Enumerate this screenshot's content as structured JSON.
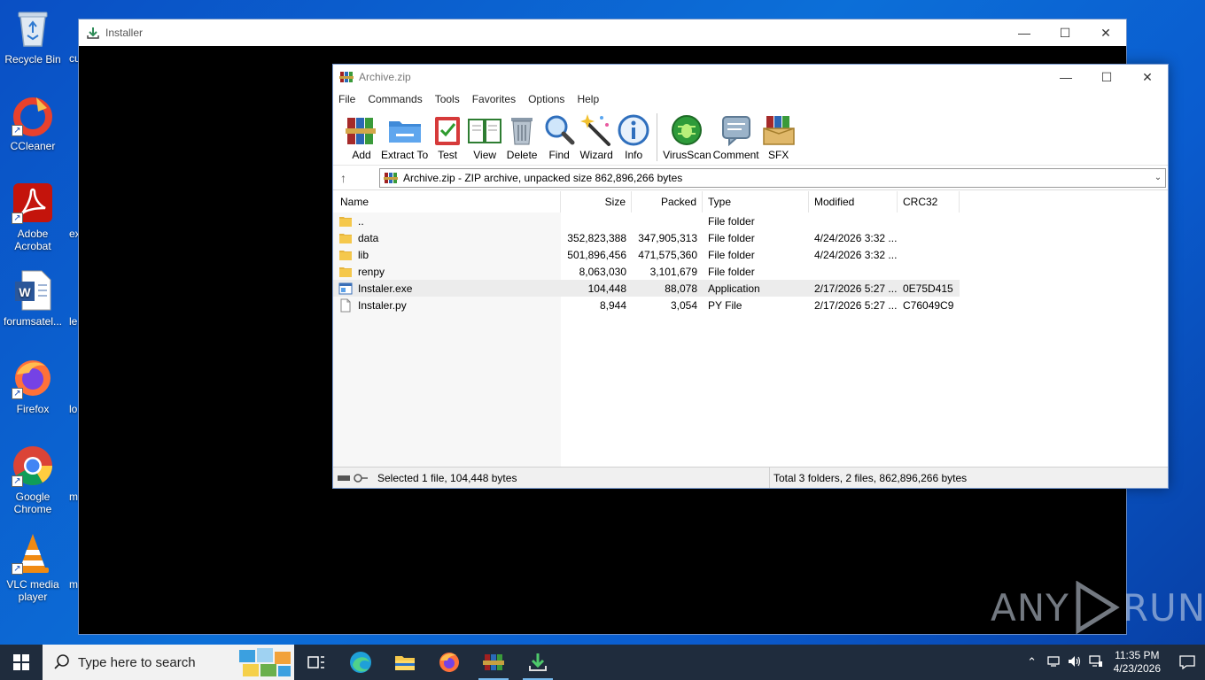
{
  "desktop": {
    "icons": [
      {
        "label": "Recycle Bin"
      },
      {
        "label": "CCleaner"
      },
      {
        "label": "Adobe Acrobat"
      },
      {
        "label": "forumsatel..."
      },
      {
        "label": "Firefox"
      },
      {
        "label": "Google Chrome"
      },
      {
        "label": "VLC media player"
      }
    ],
    "clipped_labels": [
      "cu",
      "ex",
      "le",
      "lo",
      "m",
      "m"
    ]
  },
  "installer_window": {
    "title": "Installer"
  },
  "winrar": {
    "title": "Archive.zip",
    "menu": [
      "File",
      "Commands",
      "Tools",
      "Favorites",
      "Options",
      "Help"
    ],
    "toolbar": [
      {
        "label": "Add",
        "icon": "add-books-icon"
      },
      {
        "label": "Extract To",
        "icon": "extract-folder-icon"
      },
      {
        "label": "Test",
        "icon": "test-clipboard-icon"
      },
      {
        "label": "View",
        "icon": "view-book-icon"
      },
      {
        "label": "Delete",
        "icon": "trash-icon"
      },
      {
        "label": "Find",
        "icon": "magnifier-icon"
      },
      {
        "label": "Wizard",
        "icon": "wand-icon"
      },
      {
        "label": "Info",
        "icon": "info-icon"
      },
      {
        "label": "VirusScan",
        "icon": "bug-scan-icon"
      },
      {
        "label": "Comment",
        "icon": "comment-icon"
      },
      {
        "label": "SFX",
        "icon": "sfx-box-icon"
      }
    ],
    "address": "Archive.zip - ZIP archive, unpacked size 862,896,266 bytes",
    "columns": {
      "name": "Name",
      "size": "Size",
      "packed": "Packed",
      "type": "Type",
      "modified": "Modified",
      "crc": "CRC32"
    },
    "files": [
      {
        "name": "..",
        "size": "",
        "packed": "",
        "type": "File folder",
        "modified": "",
        "crc": "",
        "kind": "folder"
      },
      {
        "name": "data",
        "size": "352,823,388",
        "packed": "347,905,313",
        "type": "File folder",
        "modified": "4/24/2026 3:32 ...",
        "crc": "",
        "kind": "folder"
      },
      {
        "name": "lib",
        "size": "501,896,456",
        "packed": "471,575,360",
        "type": "File folder",
        "modified": "4/24/2026 3:32 ...",
        "crc": "",
        "kind": "folder"
      },
      {
        "name": "renpy",
        "size": "8,063,030",
        "packed": "3,101,679",
        "type": "File folder",
        "modified": "",
        "crc": "",
        "kind": "folder"
      },
      {
        "name": "Instaler.exe",
        "size": "104,448",
        "packed": "88,078",
        "type": "Application",
        "modified": "2/17/2026 5:27 ...",
        "crc": "0E75D415",
        "kind": "exe"
      },
      {
        "name": "Instaler.py",
        "size": "8,944",
        "packed": "3,054",
        "type": "PY File",
        "modified": "2/17/2026 5:27 ...",
        "crc": "C76049C9",
        "kind": "file"
      }
    ],
    "status_left": "Selected 1 file, 104,448 bytes",
    "status_right": "Total 3 folders, 2 files, 862,896,266 bytes"
  },
  "watermark": {
    "text_left": "ANY",
    "text_right": "RUN"
  },
  "taskbar": {
    "search_placeholder": "Type here to search",
    "time": "11:35 PM",
    "date": "4/23/2026"
  },
  "colors": {
    "desktop_blue": "#0c6fd8",
    "taskbar": "#1f2c3d",
    "folder_yellow": "#f5c84c",
    "selection": "#ececec"
  }
}
